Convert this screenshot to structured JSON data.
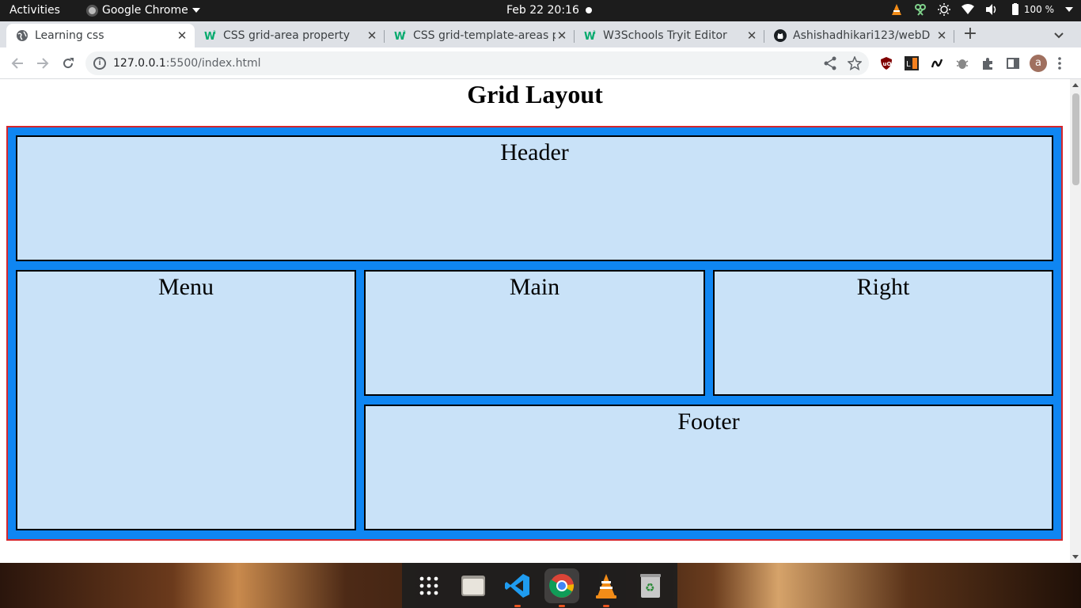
{
  "topbar": {
    "activities": "Activities",
    "app_name": "Google Chrome",
    "clock": "Feb 22  20:16",
    "battery": "100 %"
  },
  "tabs": [
    {
      "title": "Learning css",
      "favicon": "globe-icon",
      "active": true
    },
    {
      "title": "CSS grid-area property",
      "favicon": "w3schools-icon",
      "active": false
    },
    {
      "title": "CSS grid-template-areas p",
      "favicon": "w3schools-icon",
      "active": false
    },
    {
      "title": "W3Schools Tryit Editor",
      "favicon": "w3schools-icon",
      "active": false
    },
    {
      "title": "Ashishadhikari123/webD",
      "favicon": "github-icon",
      "active": false
    }
  ],
  "toolbar": {
    "url_host": "127.0.0.1",
    "url_path": ":5500/index.html",
    "profile_initial": "a"
  },
  "page": {
    "title": "Grid Layout",
    "cells": {
      "header": "Header",
      "menu": "Menu",
      "main": "Main",
      "right": "Right",
      "footer": "Footer"
    }
  },
  "colors": {
    "grid_background": "#0f86f2",
    "grid_border": "#d5262c",
    "cell_background": "#c9e2f8"
  },
  "dock": [
    "app-grid-icon",
    "files-icon",
    "vscode-icon",
    "chrome-icon",
    "vlc-icon",
    "trash-icon"
  ]
}
